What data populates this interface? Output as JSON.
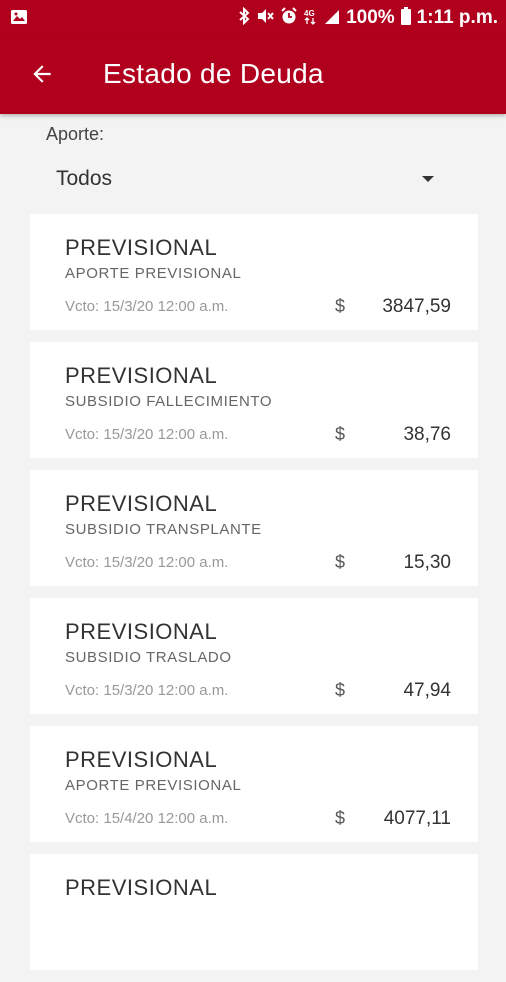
{
  "status_bar": {
    "battery_text": "100%",
    "time": "1:11 p.m.",
    "icons": [
      "image-icon",
      "bluetooth-icon",
      "mute-icon",
      "alarm-icon",
      "network-4g-icon",
      "signal-icon",
      "battery-icon"
    ]
  },
  "app_bar": {
    "title": "Estado de Deuda",
    "back_icon": "arrow-back-icon",
    "color": "#b0001e"
  },
  "filter": {
    "label": "Aporte:",
    "selected": "Todos"
  },
  "debts": [
    {
      "title": "PREVISIONAL",
      "subtitle": "APORTE PREVISIONAL",
      "due": "Vcto: 15/3/20 12:00 a.m.",
      "currency": "$",
      "amount": "3847,59"
    },
    {
      "title": "PREVISIONAL",
      "subtitle": "SUBSIDIO FALLECIMIENTO",
      "due": "Vcto: 15/3/20 12:00 a.m.",
      "currency": "$",
      "amount": "38,76"
    },
    {
      "title": "PREVISIONAL",
      "subtitle": "SUBSIDIO TRANSPLANTE",
      "due": "Vcto: 15/3/20 12:00 a.m.",
      "currency": "$",
      "amount": "15,30"
    },
    {
      "title": "PREVISIONAL",
      "subtitle": "SUBSIDIO TRASLADO",
      "due": "Vcto: 15/3/20 12:00 a.m.",
      "currency": "$",
      "amount": "47,94"
    },
    {
      "title": "PREVISIONAL",
      "subtitle": "APORTE PREVISIONAL",
      "due": "Vcto: 15/4/20 12:00 a.m.",
      "currency": "$",
      "amount": "4077,11"
    },
    {
      "title": "PREVISIONAL",
      "subtitle": "",
      "due": "",
      "currency": "",
      "amount": ""
    }
  ]
}
